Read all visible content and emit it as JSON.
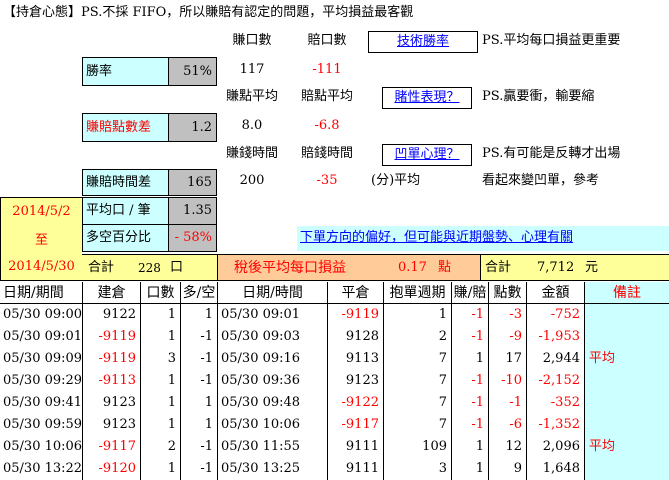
{
  "title": "【持倉心態】PS.不採 FIFO，所以賺賠有認定的問題，平均損益最客觀",
  "top": {
    "win_count_header": "賺口數",
    "loss_count_header": "賠口數",
    "tech_win_rate_link": "技術勝率",
    "note1": "PS.平均每口損益更重要",
    "win_rate_label": "勝率",
    "win_rate_value": "51%",
    "win_count": "117",
    "loss_count": "-111",
    "avg_win_pts_header": "賺點平均",
    "avg_loss_pts_header": "賠點平均",
    "gambling_link": "賭性表現？",
    "note2": "PS.贏要衝，輸要縮",
    "pts_diff_label": "賺賠點數差",
    "pts_diff_value": "1.2",
    "avg_win_pts": "8.0",
    "avg_loss_pts": "-6.8",
    "win_time_header": "賺錢時間",
    "loss_time_header": "賠錢時間",
    "concave_link": "凹單心理？",
    "note3": "PS.有可能是反轉才出場",
    "time_diff_label": "賺賠時間差",
    "time_diff_value": "165",
    "win_time": "200",
    "loss_time": "-35",
    "unit_avg": "(分)平均",
    "note4": "看起來變凹單，參考",
    "date_from": "2014/5/2",
    "date_to_word": "至",
    "date_to": "2014/5/30",
    "avg_lots_label": "平均口 / 筆",
    "avg_lots_value": "1.35",
    "ls_pct_label": "多空百分比",
    "ls_pct_value": "- 58%",
    "bias_link": "下單方向的偏好，但可能與近期盤勢、心理有關",
    "total_label": "合計",
    "total_lots": "228",
    "total_unit": "口",
    "after_tax_label": "稅後平均每口損益",
    "after_tax_value": "0.17",
    "after_tax_unit": "點",
    "total2_label": "合計",
    "total_amount": "7,712",
    "total_amount_unit": "元"
  },
  "table": {
    "headers": [
      "日期/期間",
      "建倉",
      "口數",
      "多/空",
      "日期/時間",
      "平倉",
      "抱單週期",
      "賺/賠",
      "點數",
      "金額",
      "備註"
    ],
    "rows": [
      [
        "05/30 09:00",
        "9122",
        "1",
        "1",
        "05/30 09:01",
        "-9119",
        "1",
        "-1",
        "-3",
        "-752",
        ""
      ],
      [
        "05/30 09:01",
        "-9119",
        "1",
        "-1",
        "05/30 09:03",
        "9128",
        "2",
        "-1",
        "-9",
        "-1,953",
        ""
      ],
      [
        "05/30 09:09",
        "-9119",
        "3",
        "-1",
        "05/30 09:16",
        "9113",
        "7",
        "1",
        "17",
        "2,944",
        "平均"
      ],
      [
        "05/30 09:29",
        "-9113",
        "1",
        "-1",
        "05/30 09:36",
        "9123",
        "7",
        "-1",
        "-10",
        "-2,152",
        ""
      ],
      [
        "05/30 09:41",
        "9123",
        "1",
        "1",
        "05/30 09:48",
        "-9122",
        "7",
        "-1",
        "-1",
        "-352",
        ""
      ],
      [
        "05/30 09:59",
        "9123",
        "1",
        "1",
        "05/30 10:06",
        "-9117",
        "7",
        "-1",
        "-6",
        "-1,352",
        ""
      ],
      [
        "05/30 10:06",
        "-9117",
        "2",
        "-1",
        "05/30 11:55",
        "9111",
        "109",
        "1",
        "12",
        "2,096",
        "平均"
      ],
      [
        "05/30 13:22",
        "-9120",
        "1",
        "-1",
        "05/30 13:25",
        "9111",
        "3",
        "1",
        "9",
        "1,648",
        ""
      ]
    ]
  }
}
